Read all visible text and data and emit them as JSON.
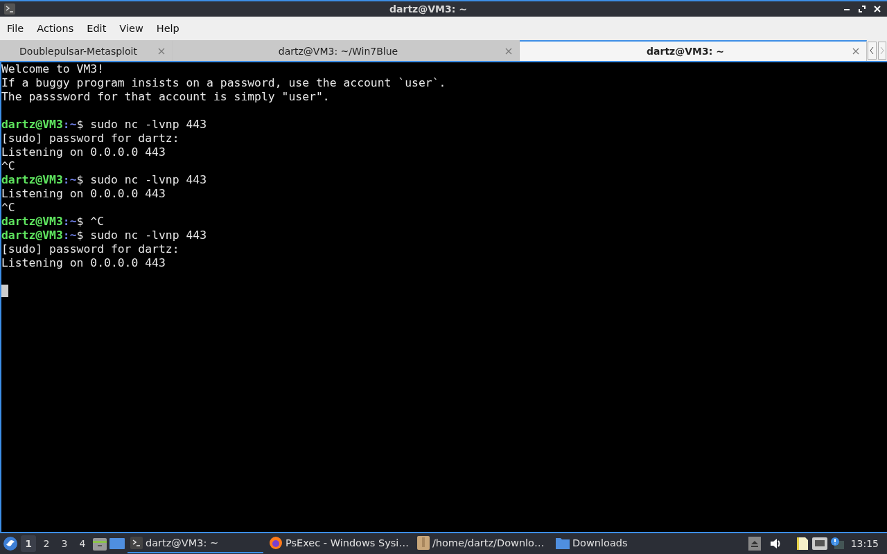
{
  "window": {
    "title": "dartz@VM3: ~"
  },
  "menu": [
    "File",
    "Actions",
    "Edit",
    "View",
    "Help"
  ],
  "tabs": [
    {
      "label": "Doublepulsar-Metasploit",
      "selected": false
    },
    {
      "label": "dartz@VM3: ~/Win7Blue",
      "selected": false
    },
    {
      "label": "dartz@VM3: ~",
      "selected": true
    }
  ],
  "terminal": {
    "lines": [
      {
        "kind": "text",
        "text": "Welcome to VM3!"
      },
      {
        "kind": "text",
        "text": "If a buggy program insists on a password, use the account `user`."
      },
      {
        "kind": "text",
        "text": "The passsword for that account is simply \"user\"."
      },
      {
        "kind": "blank"
      },
      {
        "kind": "prompt",
        "user": "dartz@VM3",
        "path": ":~",
        "command": "$ sudo nc -lvnp 443"
      },
      {
        "kind": "text",
        "text": "[sudo] password for dartz:"
      },
      {
        "kind": "text",
        "text": "Listening on 0.0.0.0 443"
      },
      {
        "kind": "text",
        "text": "^C"
      },
      {
        "kind": "prompt",
        "user": "dartz@VM3",
        "path": ":~",
        "command": "$ sudo nc -lvnp 443"
      },
      {
        "kind": "text",
        "text": "Listening on 0.0.0.0 443"
      },
      {
        "kind": "text",
        "text": "^C"
      },
      {
        "kind": "prompt",
        "user": "dartz@VM3",
        "path": ":~",
        "command": "$ ^C"
      },
      {
        "kind": "prompt",
        "user": "dartz@VM3",
        "path": ":~",
        "command": "$ sudo nc -lvnp 443"
      },
      {
        "kind": "text",
        "text": "[sudo] password for dartz:"
      },
      {
        "kind": "text",
        "text": "Listening on 0.0.0.0 443"
      },
      {
        "kind": "blank"
      },
      {
        "kind": "cursor"
      }
    ]
  },
  "taskbar": {
    "desktops": [
      {
        "label": "1",
        "selected": true
      },
      {
        "label": "2",
        "selected": false
      },
      {
        "label": "3",
        "selected": false
      },
      {
        "label": "4",
        "selected": false
      }
    ],
    "tasks": [
      {
        "kind": "terminal",
        "label": "dartz@VM3: ~",
        "selected": true
      },
      {
        "kind": "browser",
        "label": "PsExec - Windows Sysi…",
        "selected": false
      },
      {
        "kind": "archive",
        "label": "/home/dartz/Downlo…",
        "selected": false
      },
      {
        "kind": "folder",
        "label": "Downloads",
        "selected": false
      }
    ],
    "clock": "13:15"
  }
}
